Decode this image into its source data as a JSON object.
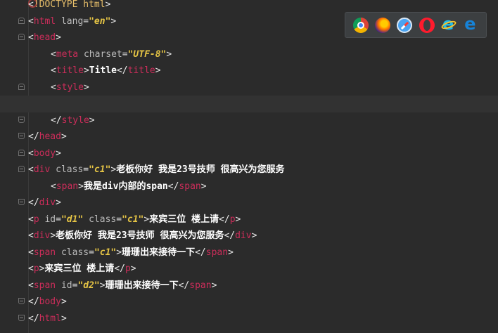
{
  "editor": {
    "lines": [
      {
        "id": 1,
        "segments": [
          [
            "br",
            "<"
          ],
          [
            "dc",
            "!DOCTYPE html"
          ],
          [
            "br",
            ">"
          ]
        ]
      },
      {
        "id": 2,
        "segments": [
          [
            "br",
            "<"
          ],
          [
            "tg",
            "html "
          ],
          [
            "at",
            "lang"
          ],
          [
            "br",
            "="
          ],
          [
            "av",
            "\"en\""
          ],
          [
            "br",
            ">"
          ]
        ]
      },
      {
        "id": 3,
        "segments": [
          [
            "br",
            "<"
          ],
          [
            "tg",
            "head"
          ],
          [
            "br",
            ">"
          ]
        ]
      },
      {
        "id": 4,
        "segments": [
          [
            "br",
            "<"
          ],
          [
            "tg",
            "meta "
          ],
          [
            "at",
            "charset"
          ],
          [
            "br",
            "="
          ],
          [
            "av",
            "\"UTF-8\""
          ],
          [
            "br",
            ">"
          ]
        ]
      },
      {
        "id": 5,
        "segments": [
          [
            "br",
            "<"
          ],
          [
            "tg",
            "title"
          ],
          [
            "br",
            ">"
          ],
          [
            "tx",
            "Title"
          ],
          [
            "br",
            "</"
          ],
          [
            "tg",
            "title"
          ],
          [
            "br",
            ">"
          ]
        ]
      },
      {
        "id": 6,
        "segments": [
          [
            "br",
            "<"
          ],
          [
            "tg",
            "style"
          ],
          [
            "br",
            ">"
          ]
        ]
      },
      {
        "id": 7,
        "segments": []
      },
      {
        "id": 8,
        "segments": [
          [
            "br",
            "</"
          ],
          [
            "tg",
            "style"
          ],
          [
            "br",
            ">"
          ]
        ]
      },
      {
        "id": 9,
        "segments": [
          [
            "br",
            "</"
          ],
          [
            "tg",
            "head"
          ],
          [
            "br",
            ">"
          ]
        ]
      },
      {
        "id": 10,
        "segments": [
          [
            "br",
            "<"
          ],
          [
            "tg",
            "body"
          ],
          [
            "br",
            ">"
          ]
        ]
      },
      {
        "id": 11,
        "segments": [
          [
            "br",
            "<"
          ],
          [
            "tg",
            "div "
          ],
          [
            "at",
            "class"
          ],
          [
            "br",
            "="
          ],
          [
            "av",
            "\"c1\""
          ],
          [
            "br",
            ">"
          ],
          [
            "tx",
            "老板你好 我是23号技师 很高兴为您服务"
          ]
        ]
      },
      {
        "id": 12,
        "segments": [
          [
            "br",
            "<"
          ],
          [
            "tg",
            "span"
          ],
          [
            "br",
            ">"
          ],
          [
            "tx",
            "我是div内部的span"
          ],
          [
            "br",
            "</"
          ],
          [
            "tg",
            "span"
          ],
          [
            "br",
            ">"
          ]
        ]
      },
      {
        "id": 13,
        "segments": [
          [
            "br",
            "</"
          ],
          [
            "tg",
            "div"
          ],
          [
            "br",
            ">"
          ]
        ]
      },
      {
        "id": 14,
        "segments": [
          [
            "br",
            "<"
          ],
          [
            "tg",
            "p "
          ],
          [
            "at",
            "id"
          ],
          [
            "br",
            "="
          ],
          [
            "av",
            "\"d1\""
          ],
          [
            "at",
            " class"
          ],
          [
            "br",
            "="
          ],
          [
            "av",
            "\"c1\""
          ],
          [
            "br",
            ">"
          ],
          [
            "tx",
            "来宾三位 楼上请"
          ],
          [
            "br",
            "</"
          ],
          [
            "tg",
            "p"
          ],
          [
            "br",
            ">"
          ]
        ]
      },
      {
        "id": 15,
        "segments": [
          [
            "br",
            "<"
          ],
          [
            "tg",
            "div"
          ],
          [
            "br",
            ">"
          ],
          [
            "tx",
            "老板你好 我是23号技师 很高兴为您服务"
          ],
          [
            "br",
            "</"
          ],
          [
            "tg",
            "div"
          ],
          [
            "br",
            ">"
          ]
        ]
      },
      {
        "id": 16,
        "segments": [
          [
            "br",
            "<"
          ],
          [
            "tg",
            "span "
          ],
          [
            "at",
            "class"
          ],
          [
            "br",
            "="
          ],
          [
            "av",
            "\"c1\""
          ],
          [
            "br",
            ">"
          ],
          [
            "tx",
            "珊珊出来接待一下"
          ],
          [
            "br",
            "</"
          ],
          [
            "tg",
            "span"
          ],
          [
            "br",
            ">"
          ]
        ]
      },
      {
        "id": 17,
        "segments": [
          [
            "br",
            "<"
          ],
          [
            "tg",
            "p"
          ],
          [
            "br",
            ">"
          ],
          [
            "tx",
            "来宾三位 楼上请"
          ],
          [
            "br",
            "</"
          ],
          [
            "tg",
            "p"
          ],
          [
            "br",
            ">"
          ]
        ]
      },
      {
        "id": 18,
        "segments": [
          [
            "br",
            "<"
          ],
          [
            "tg",
            "span "
          ],
          [
            "at",
            "id"
          ],
          [
            "br",
            "="
          ],
          [
            "av",
            "\"d2\""
          ],
          [
            "br",
            ">"
          ],
          [
            "tx",
            "珊珊出来接待一下"
          ],
          [
            "br",
            "</"
          ],
          [
            "tg",
            "span"
          ],
          [
            "br",
            ">"
          ]
        ]
      },
      {
        "id": 19,
        "segments": [
          [
            "br",
            "</"
          ],
          [
            "tg",
            "body"
          ],
          [
            "br",
            ">"
          ]
        ]
      },
      {
        "id": 20,
        "segments": [
          [
            "br",
            "</"
          ],
          [
            "tg",
            "html"
          ],
          [
            "br",
            ">"
          ]
        ]
      }
    ]
  },
  "browser_bar": {
    "icons": [
      "chrome-icon",
      "firefox-icon",
      "safari-icon",
      "opera-icon",
      "internet-explorer-icon",
      "edge-icon"
    ]
  }
}
